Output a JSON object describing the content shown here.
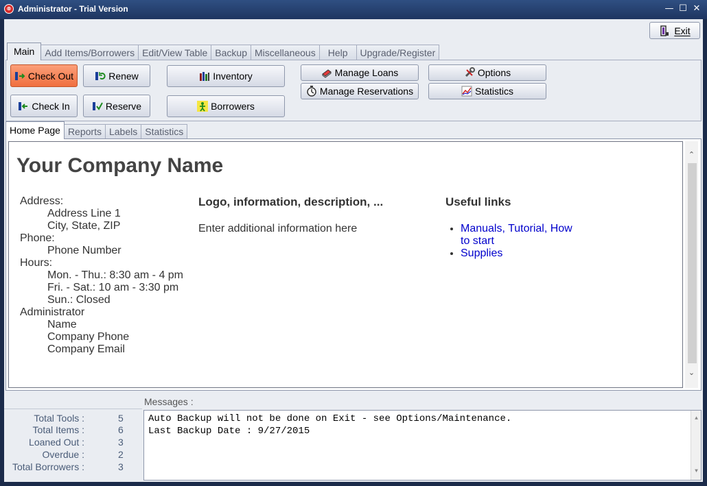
{
  "window": {
    "title": "Administrator - Trial Version"
  },
  "exit_label": "Exit",
  "menu_tabs": [
    {
      "label": "Main"
    },
    {
      "label": "Add Items/Borrowers"
    },
    {
      "label": "Edit/View Table"
    },
    {
      "label": "Backup"
    },
    {
      "label": "Miscellaneous"
    },
    {
      "label": "Help"
    },
    {
      "label": "Upgrade/Register"
    }
  ],
  "toolbar": {
    "check_out": "Check Out",
    "check_in": "Check In",
    "renew": "Renew",
    "reserve": "Reserve",
    "inventory": "Inventory",
    "borrowers": "Borrowers",
    "manage_loans": "Manage Loans",
    "manage_reservations": "Manage Reservations",
    "options": "Options",
    "statistics": "Statistics"
  },
  "sub_tabs": [
    {
      "label": "Home Page"
    },
    {
      "label": "Reports"
    },
    {
      "label": "Labels"
    },
    {
      "label": "Statistics"
    }
  ],
  "home": {
    "company_name": "Your Company Name",
    "address_label": "Address:",
    "address_line": "Address Line 1",
    "city_line": "City, State, ZIP",
    "phone_label": "Phone:",
    "phone_number": "Phone Number",
    "hours_label": "Hours:",
    "hours_1": "Mon. - Thu.: 8:30 am - 4 pm",
    "hours_2": "Fri. - Sat.: 10 am - 3:30 pm",
    "hours_3": "Sun.: Closed",
    "admin_label": "Administrator",
    "admin_name": "Name",
    "admin_phone": "Company Phone",
    "admin_email": "Company Email",
    "info_heading": "Logo, information, description, ...",
    "info_text": "Enter additional information here",
    "links_heading": "Useful links",
    "link_1": "Manuals, Tutorial, How to start",
    "link_2": "Supplies"
  },
  "messages_label": "Messages :",
  "stats": {
    "total_tools_label": "Total Tools :",
    "total_tools": "5",
    "total_items_label": "Total Items :",
    "total_items": "6",
    "loaned_out_label": "Loaned Out :",
    "loaned_out": "3",
    "overdue_label": "Overdue :",
    "overdue": "2",
    "total_borrowers_label": "Total Borrowers :",
    "total_borrowers": "3"
  },
  "messages": {
    "line_1": "Auto Backup will not be done on Exit - see Options/Maintenance.",
    "line_2": "Last Backup Date : 9/27/2015"
  },
  "colors": {
    "titlebar": "#2f4f82",
    "hot_button": "#f47f4d",
    "link": "#0000cc",
    "panel": "#eaedf2"
  }
}
